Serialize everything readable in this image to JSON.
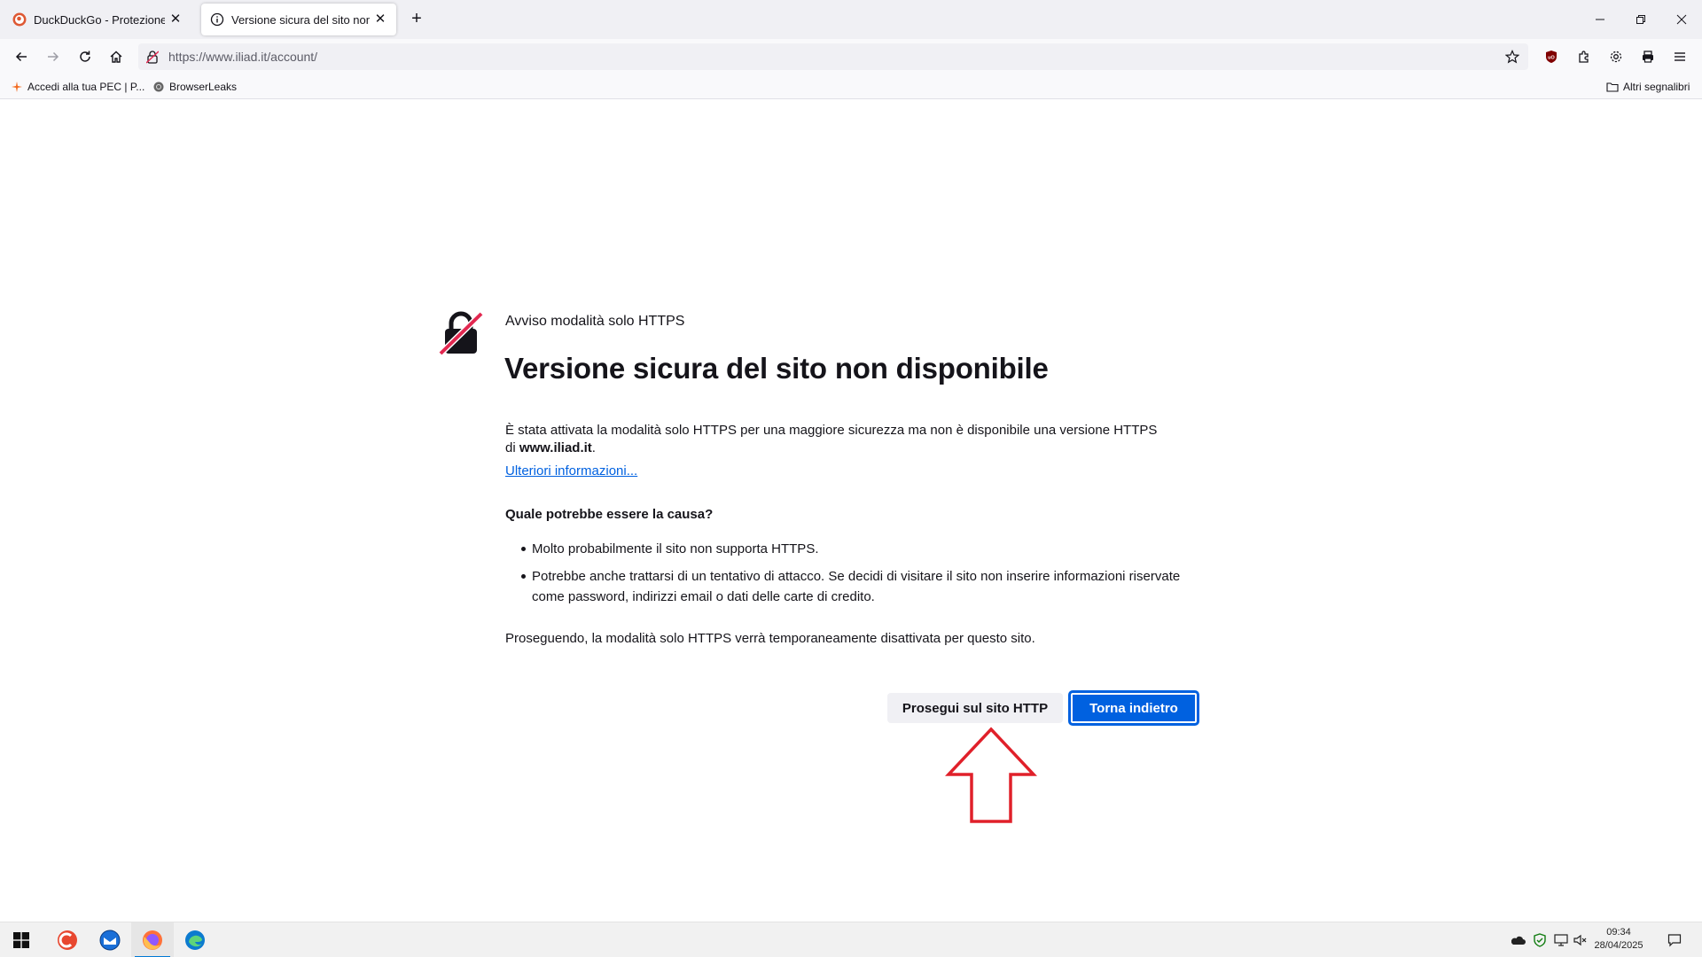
{
  "browser": {
    "tabs": [
      {
        "title": "DuckDuckGo - Protezione. Priva",
        "active": false,
        "favicon": "duckduckgo-icon"
      },
      {
        "title": "Versione sicura del sito non disp",
        "active": true,
        "favicon": "info-icon"
      }
    ],
    "url": "https://www.iliad.it/account/",
    "bookmarks": [
      {
        "label": "Accedi alla tua PEC | P...",
        "icon": "star-spark-icon"
      },
      {
        "label": "BrowserLeaks",
        "icon": "browserleaks-icon"
      }
    ],
    "other_bookmarks": "Altri segnalibri"
  },
  "page": {
    "subtitle": "Avviso modalità solo HTTPS",
    "title": "Versione sicura del sito non disponibile",
    "description_pre": "È stata attivata la modalità solo HTTPS per una maggiore sicurezza ma non è disponibile una versione HTTPS di ",
    "description_host": "www.iliad.it",
    "description_post": ".",
    "more_info": "Ulteriori informazioni...",
    "cause_heading": "Quale potrebbe essere la causa?",
    "causes": [
      "Molto probabilmente il sito non supporta HTTPS.",
      "Potrebbe anche trattarsi di un tentativo di attacco. Se decidi di visitare il sito non inserire informazioni riservate come password, indirizzi email o dati delle carte di credito."
    ],
    "proceed_note": "Proseguendo, la modalità solo HTTPS verrà temporaneamente disattivata per questo sito.",
    "btn_continue": "Prosegui sul sito HTTP",
    "btn_back": "Torna indietro"
  },
  "taskbar": {
    "time": "09:34",
    "date": "28/04/2025"
  },
  "colors": {
    "accent": "#0061e0",
    "annotation_arrow": "#e0202a",
    "warning_slash": "#e22850"
  }
}
